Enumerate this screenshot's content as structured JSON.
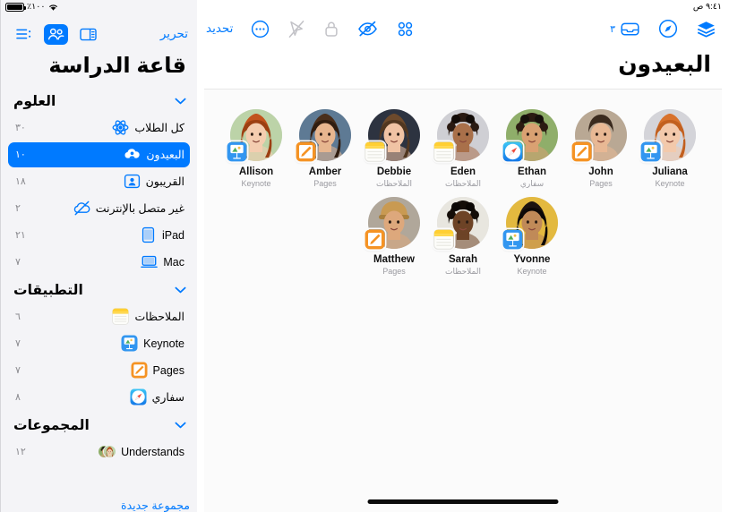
{
  "status_bar": {
    "battery_label": "٪١٠٠",
    "battery_icon": "battery-icon",
    "wifi_icon": "wifi-icon",
    "time": "٩:٤١ ص"
  },
  "main": {
    "title": "البعيدون",
    "toolbar_left": {
      "select_label": "تحديد",
      "buttons": [
        {
          "name": "more-circle-icon",
          "label": ""
        },
        {
          "name": "navigate-cursor-icon",
          "label": ""
        },
        {
          "name": "lock-icon",
          "label": ""
        },
        {
          "name": "eye-slash-icon",
          "label": ""
        },
        {
          "name": "grid-icon",
          "label": ""
        }
      ]
    },
    "toolbar_right": {
      "inbox_count": "٣",
      "inbox_icon": "inbox-tray-icon",
      "safari_icon": "compass-icon",
      "layers_icon": "layers-icon"
    },
    "students": [
      {
        "name": "Juliana",
        "app": "Keynote",
        "app_icon": "keynote-icon"
      },
      {
        "name": "John",
        "app": "Pages",
        "app_icon": "pages-icon"
      },
      {
        "name": "Ethan",
        "app": "سفاري",
        "app_icon": "safari-icon"
      },
      {
        "name": "Eden",
        "app": "الملاحظات",
        "app_icon": "notes-icon"
      },
      {
        "name": "Debbie",
        "app": "الملاحظات",
        "app_icon": "notes-icon"
      },
      {
        "name": "Amber",
        "app": "Pages",
        "app_icon": "pages-icon"
      },
      {
        "name": "Allison",
        "app": "Keynote",
        "app_icon": "keynote-icon"
      },
      {
        "name": "Yvonne",
        "app": "Keynote",
        "app_icon": "keynote-icon"
      },
      {
        "name": "Sarah",
        "app": "الملاحظات",
        "app_icon": "notes-icon"
      },
      {
        "name": "Matthew",
        "app": "Pages",
        "app_icon": "pages-icon"
      }
    ]
  },
  "sidebar": {
    "edit_label": "تحرير",
    "title": "قاعة الدراسة",
    "segment_icons": [
      {
        "name": "list-icon",
        "active": false
      },
      {
        "name": "people-icon",
        "active": true
      },
      {
        "name": "sidebar-toggle-icon",
        "active": false
      }
    ],
    "sections": [
      {
        "title": "العلوم",
        "items": [
          {
            "label": "كل الطلاب",
            "count": "٣٠",
            "icon": "atom-icon",
            "selected": false
          },
          {
            "label": "البعيدون",
            "count": "١٠",
            "icon": "cloud-person-icon",
            "selected": true
          },
          {
            "label": "القريبون",
            "count": "١٨",
            "icon": "person-frame-icon",
            "selected": false
          },
          {
            "label": "غير متصل بالإنترنت",
            "count": "٢",
            "icon": "cloud-slash-icon",
            "selected": false
          },
          {
            "label": "iPad",
            "count": "٢١",
            "icon": "ipad-icon",
            "selected": false
          },
          {
            "label": "Mac",
            "count": "٧",
            "icon": "mac-icon",
            "selected": false
          }
        ]
      },
      {
        "title": "التطبيقات",
        "items": [
          {
            "label": "الملاحظات",
            "count": "٦",
            "icon": "notes-icon",
            "selected": false
          },
          {
            "label": "Keynote",
            "count": "٧",
            "icon": "keynote-icon",
            "selected": false
          },
          {
            "label": "Pages",
            "count": "٧",
            "icon": "pages-icon",
            "selected": false
          },
          {
            "label": "سفاري",
            "count": "٨",
            "icon": "safari-icon",
            "selected": false
          }
        ]
      },
      {
        "title": "المجموعات",
        "items": [
          {
            "label": "Understands",
            "count": "١٢",
            "icon": "avatar-stack-icon",
            "selected": false
          }
        ]
      }
    ],
    "new_group_label": "مجموعة جديدة"
  },
  "colors": {
    "accent": "#007AFF",
    "sidebar_bg": "#f4f4f7",
    "canvas_bg": "#fbfbfb",
    "muted_text": "#8a8a8f"
  }
}
